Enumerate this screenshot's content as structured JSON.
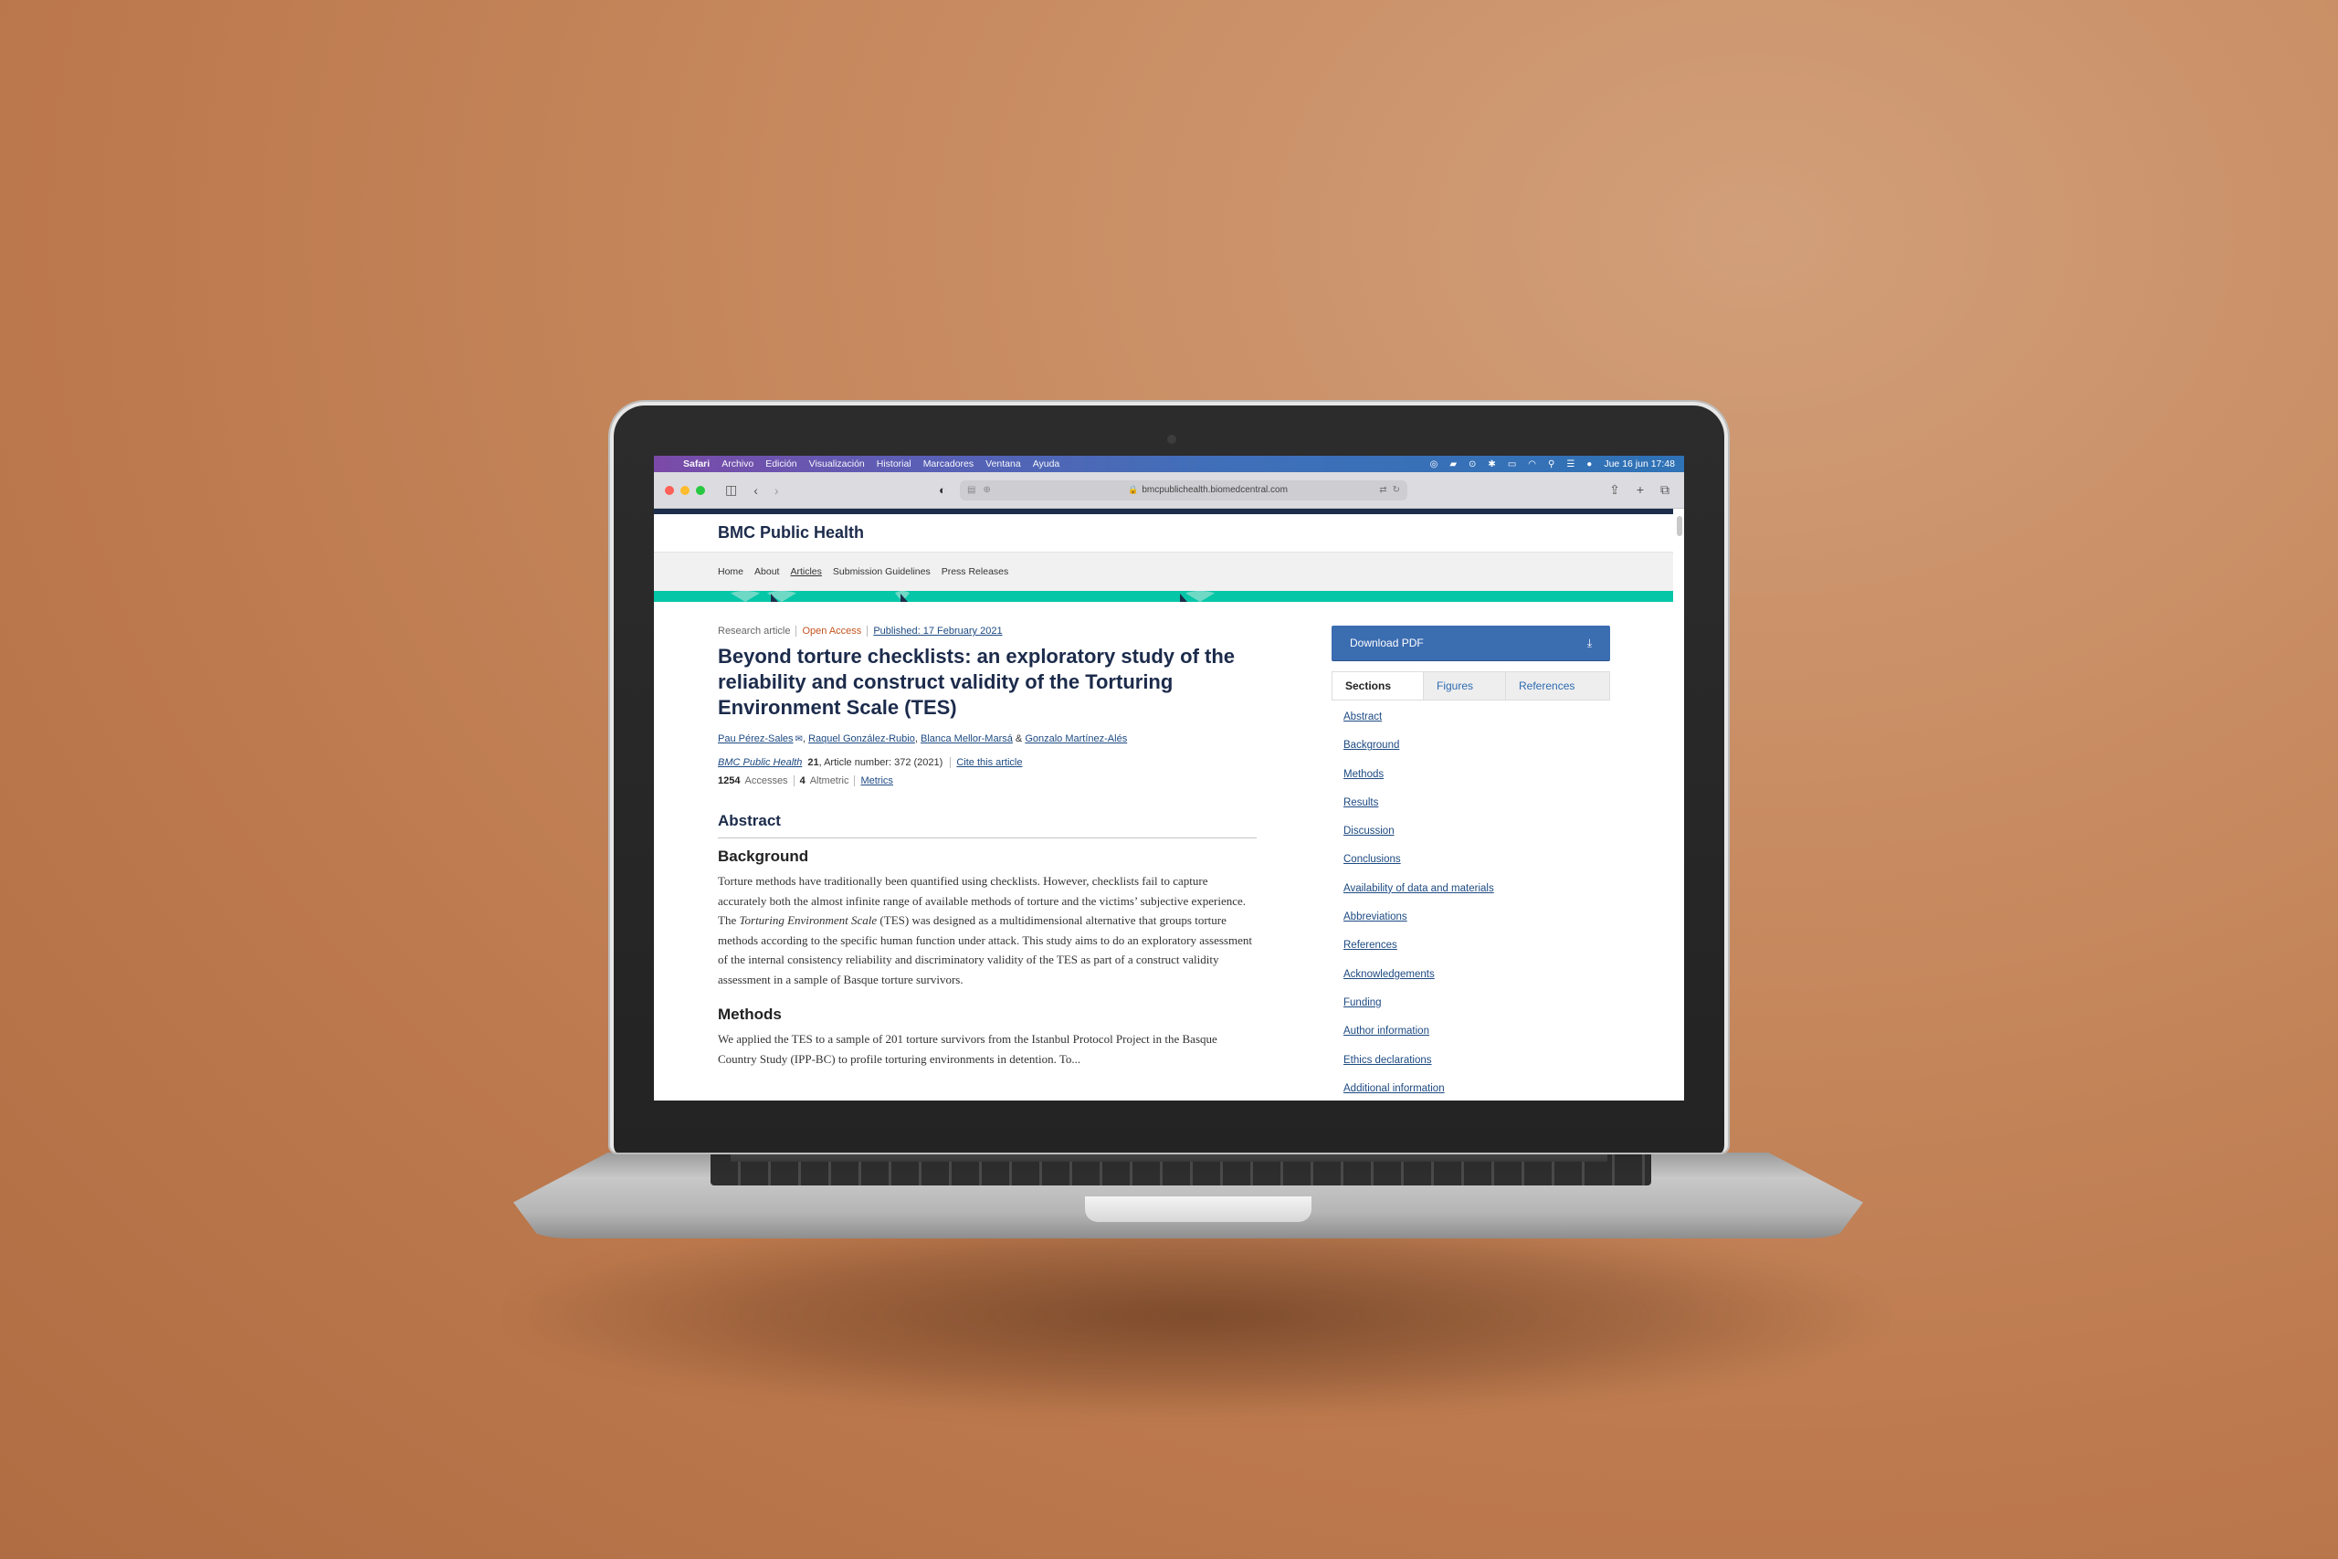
{
  "menubar": {
    "app": "Safari",
    "items": [
      "Archivo",
      "Edición",
      "Visualización",
      "Historial",
      "Marcadores",
      "Ventana",
      "Ayuda"
    ],
    "status_icons": [
      "creative-cloud-icon",
      "notification-icon",
      "play-icon",
      "bluetooth-icon",
      "battery-icon",
      "wifi-icon",
      "search-icon",
      "control-center-icon",
      "siri-icon"
    ],
    "datetime": "Jue 16 jun  17:48"
  },
  "browser": {
    "url": "bmcpublichealth.biomedcentral.com",
    "traffic_lights": {
      "close": "#fe5f57",
      "minimize": "#febc2e",
      "zoom": "#28c840"
    }
  },
  "site": {
    "journal": "BMC Public Health",
    "nav": [
      {
        "label": "Home",
        "active": false
      },
      {
        "label": "About",
        "active": false
      },
      {
        "label": "Articles",
        "active": true
      },
      {
        "label": "Submission Guidelines",
        "active": false
      },
      {
        "label": "Press Releases",
        "active": false
      }
    ],
    "colors": {
      "navy": "#1d2d4b",
      "teal": "#06c6a8",
      "accent_blue": "#3b6db1",
      "open_access": "#c5541e"
    }
  },
  "article": {
    "type": "Research article",
    "access": "Open Access",
    "published": "Published: 17 February 2021",
    "title": "Beyond torture checklists: an exploratory study of the reliability and construct validity of the Torturing Environment Scale (TES)",
    "authors": [
      {
        "name": "Pau Pérez-Sales",
        "sep": ""
      },
      {
        "name": "Raquel González-Rubio",
        "sep": ", "
      },
      {
        "name": "Blanca Mellor-Marsá",
        "sep": ", "
      },
      {
        "name": "Gonzalo Martínez-Alés",
        "sep": " & "
      }
    ],
    "journal_link": "BMC Public Health",
    "volume": "21",
    "article_number": ", Article number: 372 (2021)",
    "cite_label": "Cite this article",
    "accesses_count": "1254",
    "accesses_label": "Accesses",
    "altmetric_count": "4",
    "altmetric_label": "Altmetric",
    "metrics_label": "Metrics",
    "abstract_heading": "Abstract",
    "background_heading": "Background",
    "background_text_1": "Torture methods have traditionally been quantified using checklists. However, checklists fail to capture accurately both the almost infinite range of available methods of torture and the victims’ subjective experience. The ",
    "background_text_italic": "Torturing Environment Scale",
    "background_text_2": " (TES) was designed as a multidimensional alternative that groups torture methods according to the specific human function under attack. This study aims to do an exploratory assessment of the internal consistency reliability and discriminatory validity of the TES as part of a construct validity assessment in a sample of Basque torture survivors.",
    "methods_heading": "Methods",
    "methods_text": "We applied the TES to a sample of 201 torture survivors from the Istanbul Protocol Project in the Basque Country Study (IPP-BC) to profile torturing environments in detention. To..."
  },
  "sidebar": {
    "download_label": "Download PDF",
    "tabs": [
      "Sections",
      "Figures",
      "References"
    ],
    "active_tab": "Sections",
    "sections": [
      "Abstract",
      "Background",
      "Methods",
      "Results",
      "Discussion",
      "Conclusions",
      "Availability of data and materials",
      "Abbreviations",
      "References",
      "Acknowledgements",
      "Funding",
      "Author information",
      "Ethics declarations",
      "Additional information"
    ]
  }
}
